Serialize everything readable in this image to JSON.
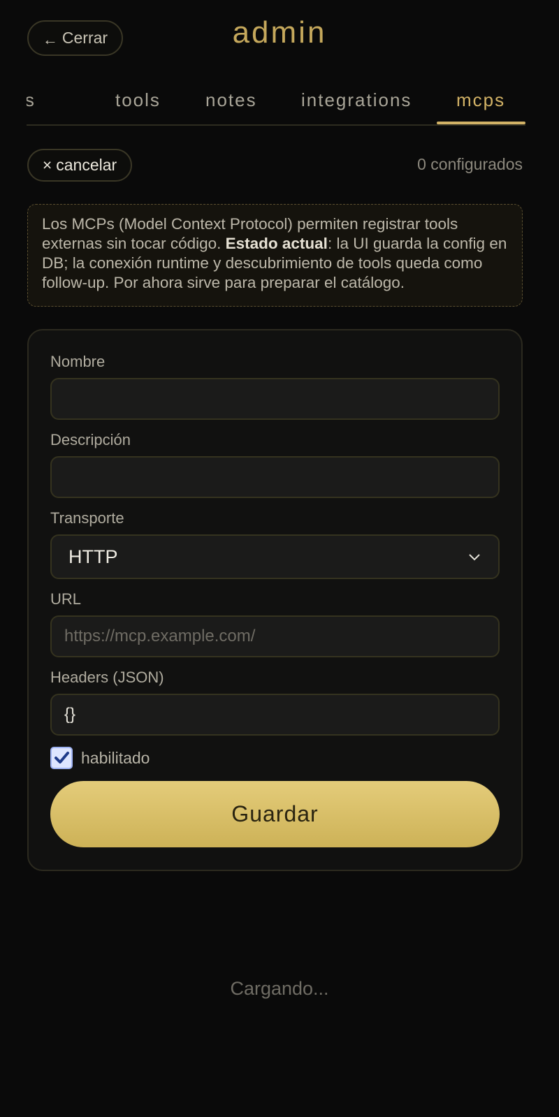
{
  "header": {
    "close_label": "Cerrar",
    "title": "admin"
  },
  "tabs": [
    {
      "label": "tions"
    },
    {
      "label": "tools"
    },
    {
      "label": "notes"
    },
    {
      "label": "integrations"
    },
    {
      "label": "mcps",
      "active": true
    }
  ],
  "actions": {
    "cancel_label": "cancelar",
    "count_text": "0 configurados"
  },
  "info": {
    "part1": "Los MCPs (Model Context Protocol) permiten registrar tools externas sin tocar código. ",
    "bold": "Estado actual",
    "part2": ": la UI guarda la config en DB; la conexión runtime y descubrimiento de tools queda como follow-up. Por ahora sirve para preparar el catálogo."
  },
  "form": {
    "name_label": "Nombre",
    "name_value": "",
    "description_label": "Descripción",
    "description_value": "",
    "transport_label": "Transporte",
    "transport_value": "HTTP",
    "url_label": "URL",
    "url_placeholder": "https://mcp.example.com/",
    "headers_label": "Headers (JSON)",
    "headers_value": "{}",
    "enabled_label": "habilitado",
    "enabled": true,
    "save_label": "Guardar"
  },
  "status": {
    "loading_text": "Cargando..."
  },
  "colors": {
    "accent": "#d2b266",
    "background": "#0a0a0a",
    "button_gold": "#e0c670"
  }
}
